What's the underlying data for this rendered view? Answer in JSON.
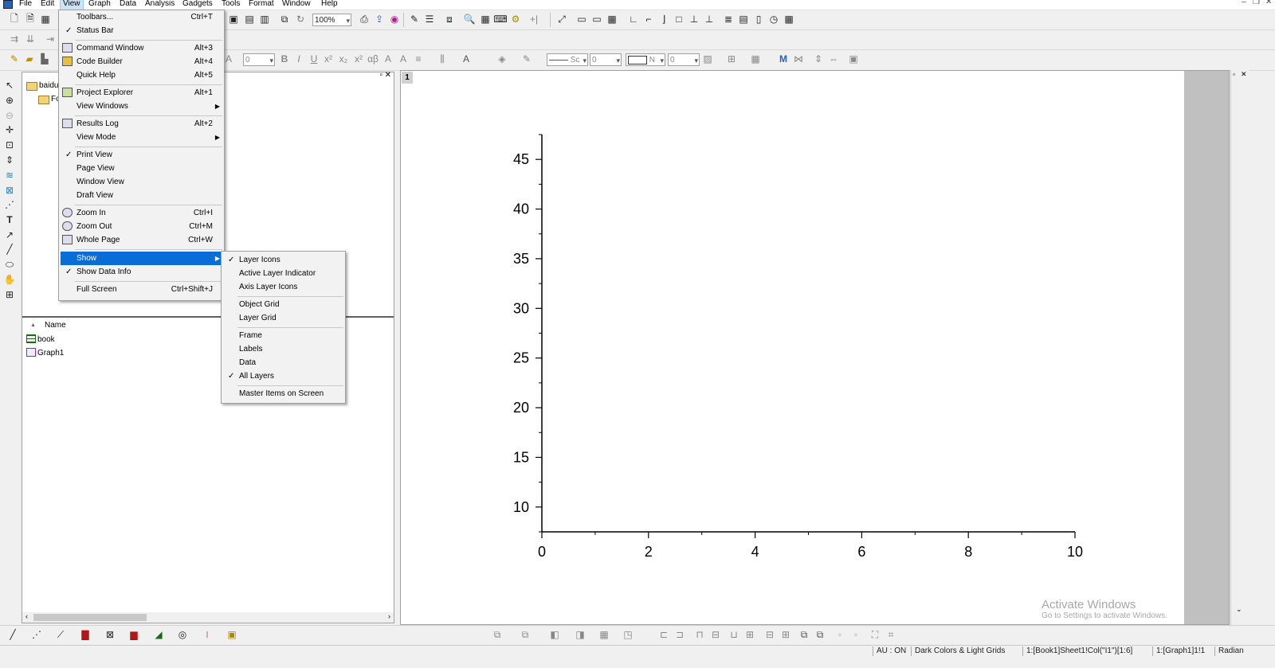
{
  "menubar": {
    "items": [
      "File",
      "Edit",
      "View",
      "Graph",
      "Data",
      "Analysis",
      "Gadgets",
      "Tools",
      "Format",
      "Window",
      "Help"
    ],
    "active": "View"
  },
  "toolbar": {
    "zoom_value": "100%",
    "font_size_value": "0",
    "line_style_value": "Sc",
    "line_width_value": "0",
    "box_value": "N",
    "box_num_value": "0"
  },
  "view_menu": {
    "items": [
      {
        "label": "Toolbars...",
        "accel": "Ctrl+T"
      },
      {
        "label": "Status Bar",
        "accel": "",
        "checked": true
      },
      {
        "label": "Command Window",
        "accel": "Alt+3"
      },
      {
        "label": "Code Builder",
        "accel": "Alt+4"
      },
      {
        "label": "Quick Help",
        "accel": "Alt+5"
      },
      {
        "label": "Project Explorer",
        "accel": "Alt+1"
      },
      {
        "label": "View Windows",
        "accel": ""
      },
      {
        "label": "Results Log",
        "accel": "Alt+2"
      },
      {
        "label": "View Mode",
        "accel": ""
      },
      {
        "label": "Print View",
        "accel": "",
        "checked": true
      },
      {
        "label": "Page View",
        "accel": ""
      },
      {
        "label": "Window View",
        "accel": ""
      },
      {
        "label": "Draft View",
        "accel": ""
      },
      {
        "label": "Zoom In",
        "accel": "Ctrl+I"
      },
      {
        "label": "Zoom Out",
        "accel": "Ctrl+M"
      },
      {
        "label": "Whole Page",
        "accel": "Ctrl+W"
      },
      {
        "label": "Show",
        "accel": ""
      },
      {
        "label": "Show Data Info",
        "accel": "",
        "checked": true
      },
      {
        "label": "Full Screen",
        "accel": "Ctrl+Shift+J"
      }
    ]
  },
  "show_submenu": {
    "items": [
      {
        "label": "Layer Icons",
        "checked": true
      },
      {
        "label": "Active Layer Indicator"
      },
      {
        "label": "Axis Layer Icons"
      },
      {
        "label": "Object Grid"
      },
      {
        "label": "Layer Grid"
      },
      {
        "label": "Frame"
      },
      {
        "label": "Labels"
      },
      {
        "label": "Data"
      },
      {
        "label": "All Layers",
        "checked": true
      },
      {
        "label": "Master Items on Screen"
      }
    ]
  },
  "project_explorer": {
    "root_folder": "baidu",
    "sub_folder": "Fo",
    "column_name": "Name",
    "items": [
      "book",
      "Graph1"
    ]
  },
  "graph": {
    "layer_tab": "1",
    "watermark": "Activate Windows",
    "watermark_sub": "Go to Settings to activate Windows."
  },
  "chart_data": {
    "type": "line",
    "title": "",
    "xlabel": "",
    "ylabel": "",
    "xlim": [
      0,
      10
    ],
    "ylim": [
      7.5,
      47.5
    ],
    "x_ticks": [
      0,
      2,
      4,
      6,
      8,
      10
    ],
    "y_ticks": [
      10,
      15,
      20,
      25,
      30,
      35,
      40,
      45
    ],
    "series": []
  },
  "statusbar": {
    "au": "AU : ON",
    "theme": "Dark Colors & Light Grids",
    "cell_ref": "1:[Book1]Sheet1!Col(\"I1\")[1:6]",
    "graph_ref": "1:[Graph1]1!1",
    "angle": "Radian"
  }
}
